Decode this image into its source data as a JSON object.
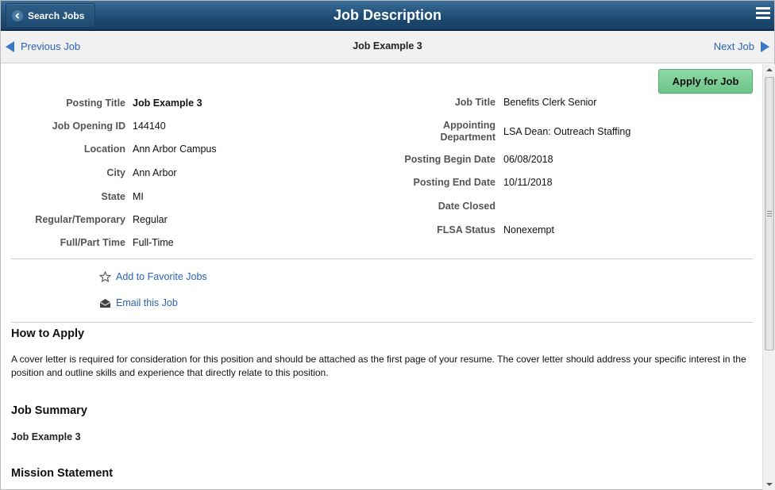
{
  "banner": {
    "back_label": "Search Jobs",
    "title": "Job Description",
    "menu_icon": "hamburger-menu-icon"
  },
  "navbar": {
    "previous_label": "Previous Job",
    "current_job": "Job Example 3",
    "next_label": "Next Job"
  },
  "actions": {
    "apply_label": "Apply for Job",
    "favorite_label": "Add to Favorite Jobs",
    "email_label": "Email this Job"
  },
  "left_fields": [
    {
      "label": "Posting Title",
      "value": "Job Example 3"
    },
    {
      "label": "Job Opening ID",
      "value": "144140"
    },
    {
      "label": "Location",
      "value": "Ann Arbor Campus"
    },
    {
      "label": "City",
      "value": "Ann Arbor"
    },
    {
      "label": "State",
      "value": "MI"
    },
    {
      "label": "Regular/Temporary",
      "value": "Regular"
    },
    {
      "label": "Full/Part Time",
      "value": "Full-Time"
    }
  ],
  "right_fields": [
    {
      "label": "Job Title",
      "value": "Benefits Clerk Senior"
    },
    {
      "label_line1": "Appointing",
      "label_line2": "Department",
      "value": "LSA Dean: Outreach Staffing"
    },
    {
      "label": "Posting Begin Date",
      "value": "06/08/2018"
    },
    {
      "label": "Posting End Date",
      "value": "10/11/2018"
    },
    {
      "label": "Date Closed",
      "value": ""
    },
    {
      "label": "FLSA Status",
      "value": "Nonexempt"
    }
  ],
  "sections": {
    "how_to_apply": {
      "heading": "How to Apply",
      "text": "A cover letter is required for consideration for this position and should be attached as the first page of your resume. The cover letter should address your specific interest in the position and outline skills and experience that directly relate to this position."
    },
    "job_summary": {
      "heading": "Job Summary",
      "text": "Job Example 3"
    },
    "mission_statement": {
      "heading": "Mission Statement"
    }
  },
  "colors": {
    "banner": "#1f4d75",
    "link": "#2b63b5",
    "apply_button": "#7ccd96"
  }
}
